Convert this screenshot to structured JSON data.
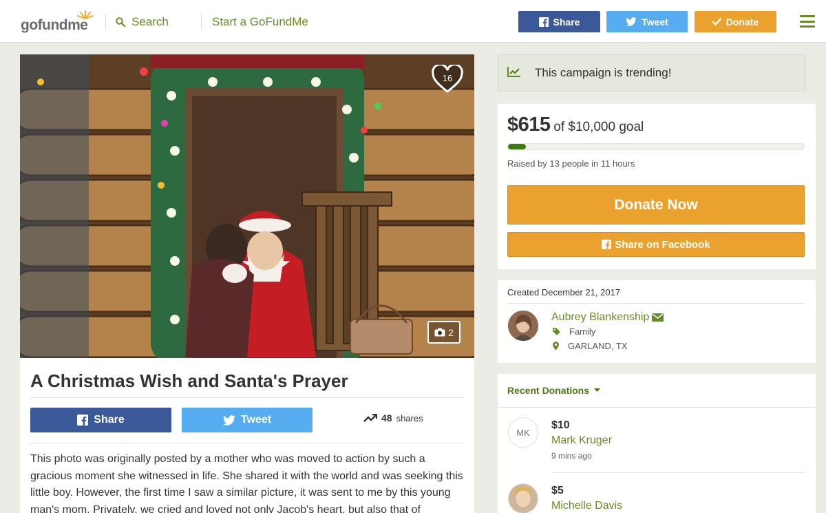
{
  "header": {
    "logo": "gofundme",
    "search_label": "Search",
    "start_label": "Start a GoFundMe",
    "share_label": "Share",
    "tweet_label": "Tweet",
    "donate_label": "Donate"
  },
  "campaign": {
    "heart_count": "16",
    "photo_count": "2",
    "title": "A Christmas Wish and Santa's Prayer",
    "share_label": "Share",
    "tweet_label": "Tweet",
    "shares_count": "48",
    "shares_suffix": "shares",
    "story": "This photo was originally posted by a mother who was moved to action by such a gracious moment she witnessed in life. She shared it with the world and was seeking this little boy.  However, the first time I saw a similar picture, it was sent to me by this young man's mom. Privately, we cried and loved not only Jacob's heart, but also that of"
  },
  "sidebar": {
    "trending_text": "This campaign is trending!",
    "raised_amount": "$615",
    "goal_text": "of $10,000 goal",
    "progress_percent": 6.15,
    "raised_by": "Raised by 13 people in 11 hours",
    "donate_now_label": "Donate Now",
    "share_facebook_label": "Share on Facebook",
    "created": "Created December 21, 2017",
    "organizer": {
      "name": "Aubrey Blankenship",
      "category": "Family",
      "location": "GARLAND, TX"
    },
    "recent_label": "Recent Donations",
    "donations": [
      {
        "initials": "MK",
        "amount": "$10",
        "name": "Mark Kruger",
        "time": "9 mins ago"
      },
      {
        "initials": "",
        "amount": "$5",
        "name": "Michelle Davis",
        "time": ""
      }
    ]
  },
  "colors": {
    "brand_green": "#6a8a2a",
    "facebook": "#3b5998",
    "twitter": "#55acee",
    "donate_orange": "#eaa12e",
    "progress_green": "#3d7a12"
  }
}
